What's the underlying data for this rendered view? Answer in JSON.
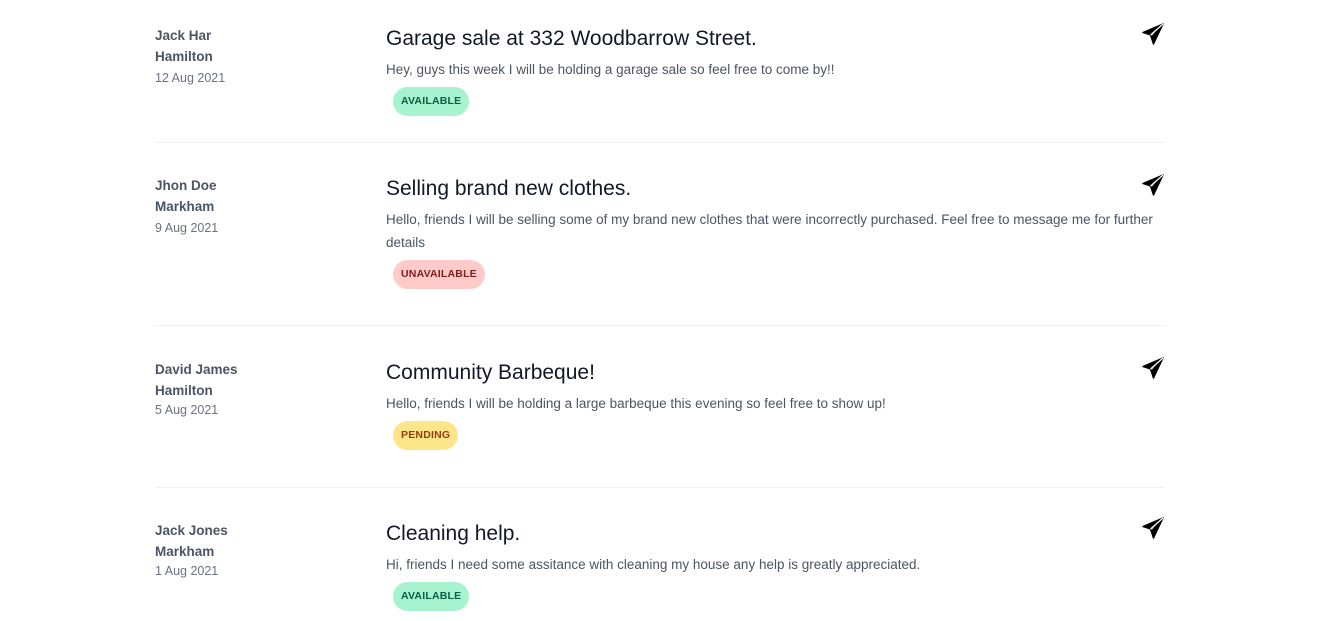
{
  "posts": [
    {
      "author": "Jack Har",
      "location": "Hamilton",
      "date": "12 Aug 2021",
      "title": "Garage sale at 332 Woodbarrow Street.",
      "description": "Hey, guys this week I will be holding a garage sale so feel free to come by!!",
      "status": "AVAILABLE"
    },
    {
      "author": "Jhon Doe",
      "location": "Markham",
      "date": "9 Aug 2021",
      "title": "Selling brand new clothes.",
      "description": "Hello, friends I will be selling some of my brand new clothes that were incorrectly purchased. Feel free to message me for further details",
      "status": "UNAVAILABLE"
    },
    {
      "author": "David James",
      "location": "Hamilton",
      "date": "5 Aug 2021",
      "title": "Community Barbeque!",
      "description": "Hello, friends I will be holding a large barbeque this evening so feel free to show up!",
      "status": "PENDING"
    },
    {
      "author": "Jack Jones",
      "location": "Markham",
      "date": "1 Aug 2021",
      "title": "Cleaning help.",
      "description": "Hi, friends I need some assitance with cleaning my house any help is greatly appreciated.",
      "status": "AVAILABLE"
    }
  ],
  "icons": {
    "send": "paper-plane-icon"
  },
  "colors": {
    "available_bg": "#a7f3d0",
    "available_text": "#065f46",
    "unavailable_bg": "#fecaca",
    "unavailable_text": "#7f1d1d",
    "pending_bg": "#fde68a",
    "pending_text": "#92400e"
  }
}
